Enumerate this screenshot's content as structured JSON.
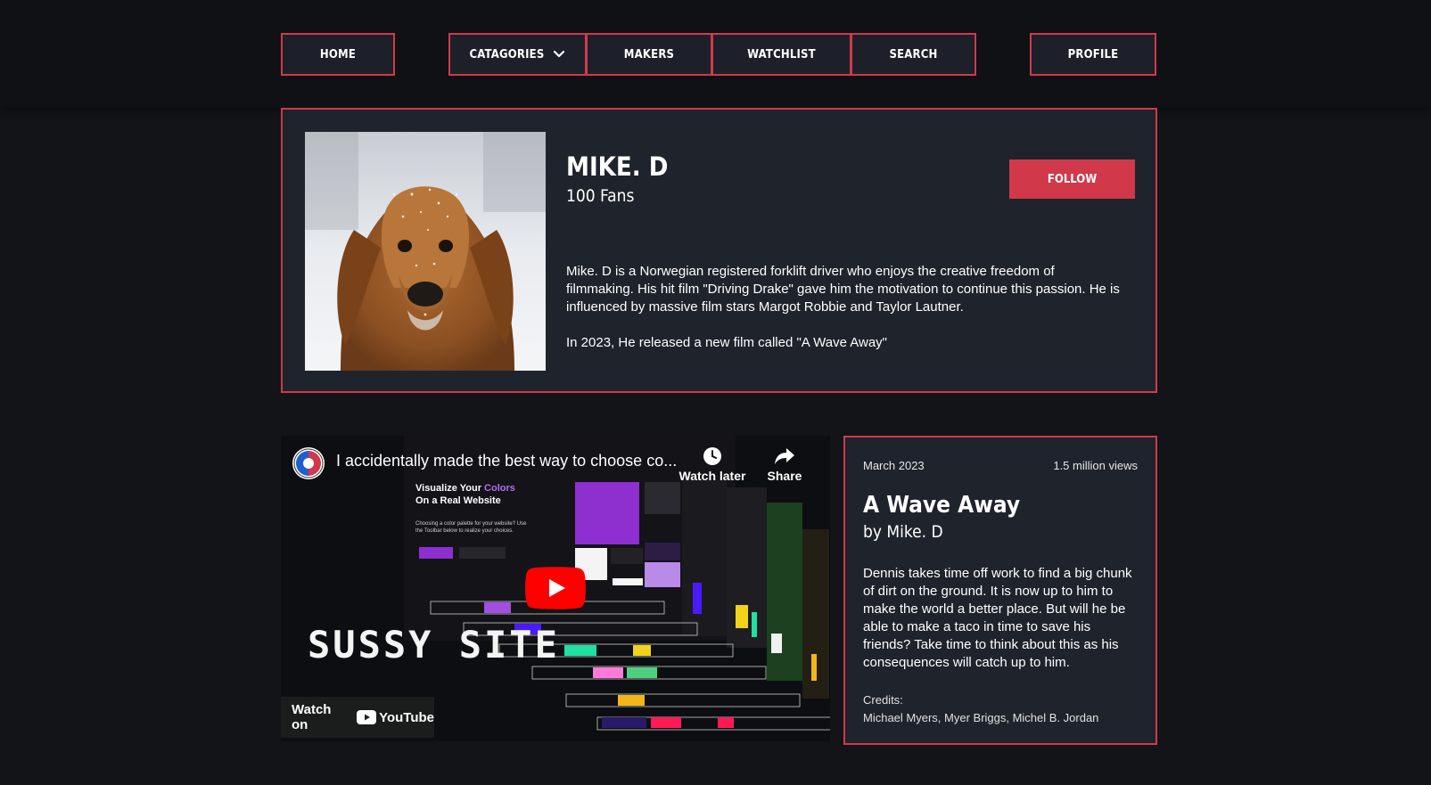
{
  "nav": {
    "home": "HOME",
    "categories": "CATAGORIES",
    "makers": "MAKERS",
    "watchlist": "WATCHLIST",
    "search": "SEARCH",
    "profile": "PROFILE"
  },
  "maker": {
    "name": "MIKE. D",
    "fans": "100 Fans",
    "follow_label": "FOLLOW",
    "bio_1": "Mike. D is a Norwegian registered forklift driver who enjoys the creative freedom of filmmaking. His hit film \"Driving Drake\" gave him the motivation to continue this passion. He is influenced by massive film stars Margot Robbie and Taylor Lautner.",
    "bio_2": "In 2023, He released a new film called \"A Wave Away\""
  },
  "video": {
    "title": "I accidentally made the best way to choose co...",
    "watch_later": "Watch later",
    "share": "Share",
    "watch_on": "Watch on",
    "youtube": "YouTube",
    "thumb_heading_1": "Visualize Your ",
    "thumb_heading_accent": "Colors",
    "thumb_heading_2": "On a Real Website",
    "thumb_sub": "Choosing a color palette for your website? Use the Toolbar below to realize your choices.",
    "thumb_brand": "SUSSY SITE"
  },
  "film": {
    "date": "March 2023",
    "views": "1.5 million views",
    "title": "A Wave Away",
    "by": "by Mike. D",
    "description": "Dennis takes time off work to find a big chunk of dirt on the ground. It is now up to him to make the world a better place. But will he be able to make a taco in time to save his friends? Take time to think about this as his consequences will catch up to him.",
    "credits_label": "Credits:",
    "credits": "Michael Myers, Myer Briggs, Michel B. Jordan"
  },
  "colors": {
    "accent": "#d1394a",
    "background": "#121418",
    "card": "#1f232c"
  }
}
